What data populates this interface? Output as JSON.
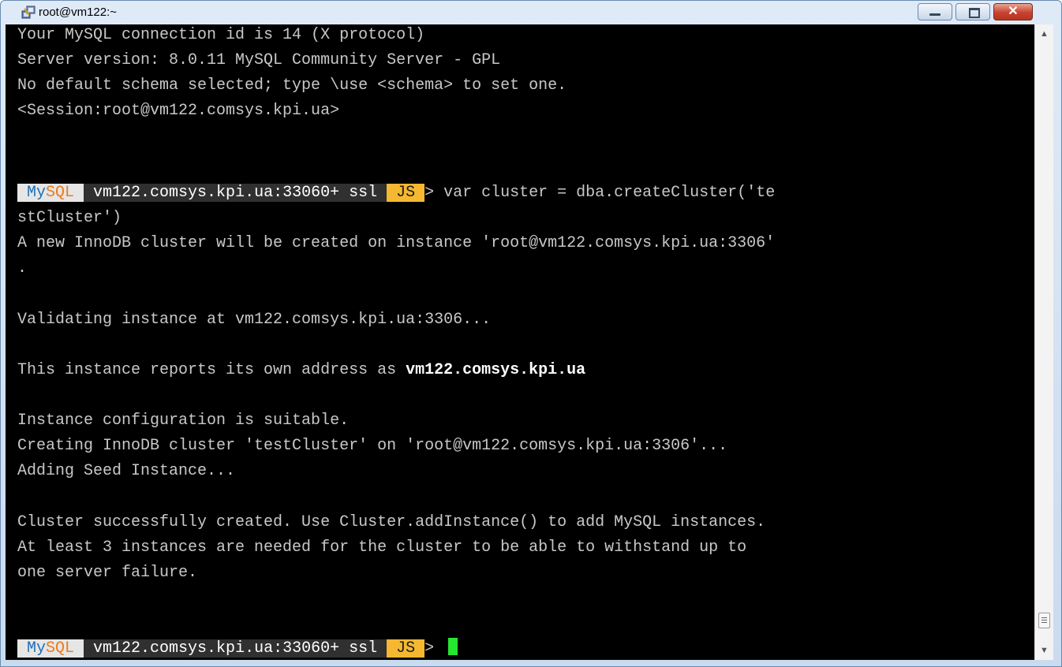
{
  "window": {
    "title": "root@vm122:~",
    "icon": "putty-icon",
    "controls": {
      "minimize": "minimize-icon",
      "maximize": "maximize-icon",
      "close": "✕"
    }
  },
  "terminal": {
    "colors": {
      "background": "#000000",
      "text": "#c8c8c8",
      "cursor": "#27e630",
      "js_badge": "#f5b830"
    },
    "lines": [
      "Your MySQL connection id is 14 (X protocol)",
      "Server version: 8.0.11 MySQL Community Server - GPL",
      "No default schema selected; type \\use <schema> to set one.",
      "<Session:root@vm122.comsys.kpi.ua>",
      "stCluster')",
      "A new InnoDB cluster will be created on instance 'root@vm122.comsys.kpi.ua:3306'",
      ".",
      "Validating instance at vm122.comsys.kpi.ua:3306...",
      "This instance reports its own address as ",
      "vm122.comsys.kpi.ua",
      "Instance configuration is suitable.",
      "Creating InnoDB cluster 'testCluster' on 'root@vm122.comsys.kpi.ua:3306'...",
      "Adding Seed Instance...",
      "Cluster successfully created. Use Cluster.addInstance() to add MySQL instances.",
      "At least 3 instances are needed for the cluster to be able to withstand up to",
      "one server failure."
    ],
    "prompt": {
      "mysql_my": " My",
      "mysql_sql": "SQL ",
      "host": " vm122.comsys.kpi.ua:33060+ ssl ",
      "mode": " JS ",
      "caret": "> "
    },
    "command_1": "var cluster = dba.createCluster('te"
  },
  "scrollbar": {
    "up_icon": "▲",
    "down_icon": "▼"
  }
}
